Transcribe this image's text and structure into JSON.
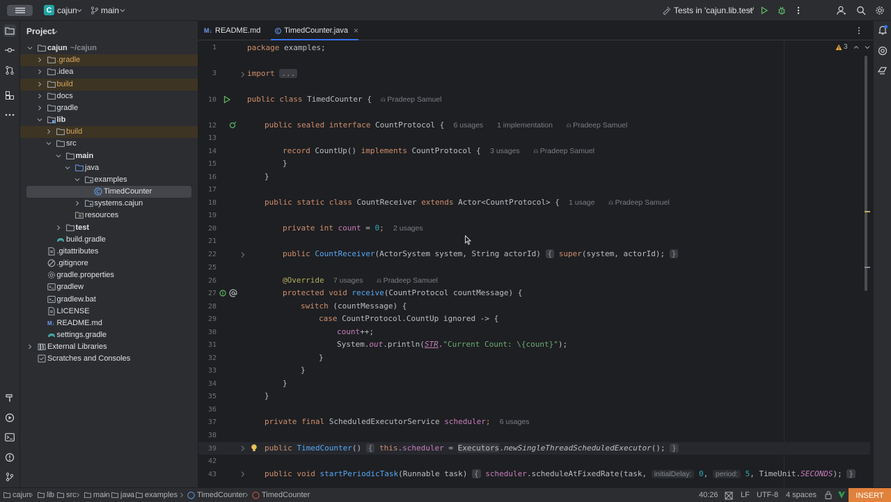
{
  "titlebar": {
    "project_letter": "C",
    "project_name": "cajun",
    "branch": "main",
    "run_config": "Tests in 'cajun.lib.test'"
  },
  "project_panel": {
    "title": "Project",
    "tree": [
      {
        "label": "cajun",
        "sub": "~/cajun",
        "depth": 0,
        "expanded": true,
        "icon": "folder",
        "bold": true
      },
      {
        "label": ".gradle",
        "depth": 1,
        "expanded": false,
        "icon": "folder",
        "excluded": true
      },
      {
        "label": ".idea",
        "depth": 1,
        "expanded": false,
        "icon": "folder"
      },
      {
        "label": "build",
        "depth": 1,
        "expanded": false,
        "icon": "folder",
        "excluded": true
      },
      {
        "label": "docs",
        "depth": 1,
        "expanded": false,
        "icon": "folder"
      },
      {
        "label": "gradle",
        "depth": 1,
        "expanded": false,
        "icon": "folder"
      },
      {
        "label": "lib",
        "depth": 1,
        "expanded": true,
        "icon": "module",
        "bold": true
      },
      {
        "label": "build",
        "depth": 2,
        "expanded": false,
        "icon": "folder",
        "excluded": true
      },
      {
        "label": "src",
        "depth": 2,
        "expanded": true,
        "icon": "folder"
      },
      {
        "label": "main",
        "depth": 3,
        "expanded": true,
        "icon": "folder",
        "bold": true
      },
      {
        "label": "java",
        "depth": 4,
        "expanded": true,
        "icon": "src-folder"
      },
      {
        "label": "examples",
        "depth": 5,
        "expanded": true,
        "icon": "package"
      },
      {
        "label": "TimedCounter",
        "depth": 6,
        "icon": "class",
        "selected": true
      },
      {
        "label": "systems.cajun",
        "depth": 5,
        "expanded": false,
        "icon": "package"
      },
      {
        "label": "resources",
        "depth": 4,
        "icon": "res-folder"
      },
      {
        "label": "test",
        "depth": 3,
        "expanded": false,
        "icon": "folder",
        "bold": true
      },
      {
        "label": "build.gradle",
        "depth": 2,
        "icon": "gradle"
      },
      {
        "label": ".gitattributes",
        "depth": 1,
        "icon": "file"
      },
      {
        "label": ".gitignore",
        "depth": 1,
        "icon": "ignore"
      },
      {
        "label": "gradle.properties",
        "depth": 1,
        "icon": "gear"
      },
      {
        "label": "gradlew",
        "depth": 1,
        "icon": "script"
      },
      {
        "label": "gradlew.bat",
        "depth": 1,
        "icon": "script"
      },
      {
        "label": "LICENSE",
        "depth": 1,
        "icon": "file"
      },
      {
        "label": "README.md",
        "depth": 1,
        "icon": "md"
      },
      {
        "label": "settings.gradle",
        "depth": 1,
        "icon": "gradle"
      },
      {
        "label": "External Libraries",
        "depth": 0,
        "expanded": false,
        "icon": "library"
      },
      {
        "label": "Scratches and Consoles",
        "depth": 0,
        "icon": "scratch"
      }
    ]
  },
  "tabs": [
    {
      "label": "README.md",
      "badge": "M↓",
      "active": false
    },
    {
      "label": "TimedCounter.java",
      "active": true,
      "close": "×"
    }
  ],
  "editor": {
    "warnings_count": "3",
    "lines": {
      "l1": {
        "num": "1",
        "kw": "package",
        "rest": " examples;"
      },
      "l3": {
        "num": "3",
        "kw": "import",
        "fold": "..."
      },
      "l10": {
        "num": "10",
        "kw": "public class",
        "name": " TimedCounter {",
        "author": "Pradeep Samuel"
      },
      "l12": {
        "num": "12",
        "kw": "public sealed interface",
        "name": " CountProtocol {",
        "usages": "6 usages",
        "impl": "1 implementation",
        "author": "Pradeep Samuel"
      },
      "l13": {
        "num": "13"
      },
      "l14": {
        "num": "14",
        "kw": "record",
        "name": " CountUp() ",
        "kw2": "implements",
        "rest": " CountProtocol {",
        "usages": "3 usages",
        "author": "Pradeep Samuel"
      },
      "l15": {
        "num": "15",
        "text": "}"
      },
      "l16": {
        "num": "16",
        "text": "}"
      },
      "l17": {
        "num": "17"
      },
      "l18": {
        "num": "18",
        "kw": "public static class",
        "name": " CountReceiver ",
        "kw2": "extends",
        "rest": " Actor<CountProtocol> {",
        "usages": "1 usage",
        "author": "Pradeep Samuel"
      },
      "l19": {
        "num": "19"
      },
      "l20": {
        "num": "20",
        "kw": "private int",
        "fld": " count",
        "rest": " = ",
        "n": "0",
        "semi": ";",
        "usages": "2 usages"
      },
      "l21": {
        "num": "21"
      },
      "l22": {
        "num": "22",
        "kw": "public",
        "fn": " CountReceiver",
        "rest": "(ActorSystem system, String actorId)",
        "fold_open": "{",
        "kw2": "super",
        "rest2": "(system, actorId);",
        "fold_close": "}"
      },
      "l25": {
        "num": "25"
      },
      "l26": {
        "num": "26",
        "ann": "@Override",
        "usages": "7 usages",
        "author": "Pradeep Samuel"
      },
      "l27": {
        "num": "27",
        "kw": "protected void",
        "fn": " receive",
        "rest": "(CountProtocol countMessage) {"
      },
      "l28": {
        "num": "28",
        "kw": "switch",
        "rest": " (countMessage) {"
      },
      "l29": {
        "num": "29",
        "kw": "case",
        "rest": " CountProtocol.CountUp ignored -> {"
      },
      "l30": {
        "num": "30",
        "fld": "count",
        "rest": "++;"
      },
      "l31": {
        "num": "31",
        "pre": "System.",
        "out": "out",
        "mid": ".println(",
        "str_t": "STR",
        "dot": ".",
        "str": "\"Current Count: \\{count}\"",
        "end": ");"
      },
      "l32": {
        "num": "32",
        "text": "}"
      },
      "l33": {
        "num": "33",
        "text": "}"
      },
      "l34": {
        "num": "34",
        "text": "}"
      },
      "l35": {
        "num": "35",
        "text": "}"
      },
      "l36": {
        "num": "36"
      },
      "l37": {
        "num": "37",
        "kw": "private final",
        "rest": " ScheduledExecutorService ",
        "fld": "scheduler",
        "semi": ";",
        "usages": "6 usages"
      },
      "l38": {
        "num": "38"
      },
      "l39": {
        "num": "39",
        "kw": "public",
        "fn": " TimedCounter",
        "rest": "()",
        "fold_open": "{",
        "kw2": " this",
        "dot": ".",
        "fld": "scheduler",
        "eq": " = ",
        "cls": "Executors",
        "dot2": ".",
        "call": "newSingleThreadScheduledExecutor",
        "end": "();",
        "fold_close": "}"
      },
      "l42": {
        "num": "42"
      },
      "l43": {
        "num": "43",
        "kw": "public void",
        "fn": " startPeriodicTask",
        "rest": "(Runnable task)",
        "fold_open": "{",
        "fld": " scheduler",
        "mid": ".scheduleAtFixedRate(task, ",
        "hint1": "initialDelay:",
        "n1": "0",
        "comma": ", ",
        "hint2": "period:",
        "n2": "5",
        "mid2": ", TimeUnit.",
        "const": "SECONDS",
        "end": ");",
        "fold_close": "}"
      }
    }
  },
  "breadcrumbs": [
    "cajun",
    "lib",
    "src",
    "main",
    "java",
    "examples",
    "TimedCounter",
    "TimedCounter"
  ],
  "status": {
    "position": "40:26",
    "line_sep": "LF",
    "encoding": "UTF-8",
    "indent": "4 spaces",
    "mode": "INSERT"
  },
  "colors": {
    "accent": "#3574f0",
    "insert_badge": "#e0813c",
    "project_badge": "#21a3a6"
  }
}
